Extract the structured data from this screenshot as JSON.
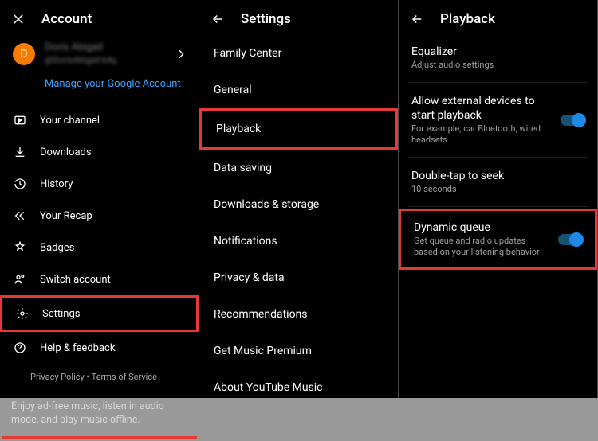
{
  "panel_account": {
    "header_title": "Account",
    "profile": {
      "initial": "D",
      "name": "Doris Abigail",
      "handle": "@DorisAbigail-k4q"
    },
    "manage_link": "Manage your Google Account",
    "menu": [
      {
        "icon": "channel",
        "label": "Your channel"
      },
      {
        "icon": "download",
        "label": "Downloads"
      },
      {
        "icon": "history",
        "label": "History"
      },
      {
        "icon": "recap",
        "label": "Your Recap"
      },
      {
        "icon": "badges",
        "label": "Badges"
      },
      {
        "icon": "switch",
        "label": "Switch account"
      },
      {
        "icon": "settings",
        "label": "Settings"
      },
      {
        "icon": "help",
        "label": "Help & feedback"
      }
    ],
    "footer_links": "Privacy Policy  •  Terms of Service",
    "promo": "Enjoy ad-free music, listen in audio mode, and play music offline."
  },
  "panel_settings": {
    "header_title": "Settings",
    "items": [
      "Family Center",
      "General",
      "Playback",
      "Data saving",
      "Downloads & storage",
      "Notifications",
      "Privacy & data",
      "Recommendations",
      "Get Music Premium",
      "About YouTube Music"
    ]
  },
  "panel_playback": {
    "header_title": "Playback",
    "items": [
      {
        "title": "Equalizer",
        "sub": "Adjust audio settings",
        "toggle": false
      },
      {
        "title": "Allow external devices to start playback",
        "sub": "For example, car Bluetooth, wired headsets",
        "toggle": true
      },
      {
        "title": "Double-tap to seek",
        "sub": "10 seconds",
        "toggle": false
      },
      {
        "title": "Dynamic queue",
        "sub": "Get queue and radio updates based on your listening behavior",
        "toggle": true
      }
    ]
  },
  "highlight_color": "#e53935"
}
